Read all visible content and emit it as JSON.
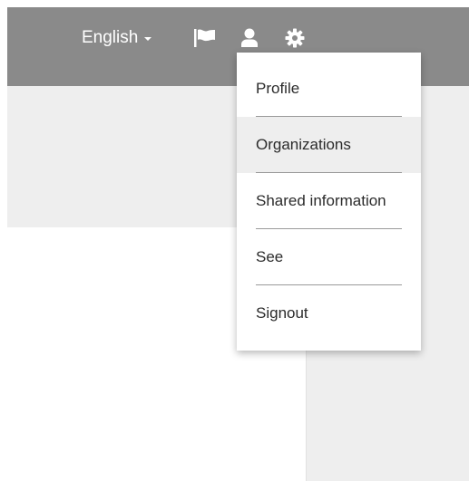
{
  "topbar": {
    "language_label": "English",
    "icons": [
      "flag-icon",
      "user-icon",
      "gear-icon"
    ]
  },
  "menu": {
    "items": [
      {
        "label": "Profile"
      },
      {
        "label": "Organizations",
        "highlighted": true
      },
      {
        "label": "Shared information"
      },
      {
        "label": "See"
      },
      {
        "label": "Signout"
      }
    ]
  },
  "colors": {
    "topbar": "#8a8a8a",
    "panel": "#eeeeee",
    "menu_text": "#2b2b2b",
    "icon": "#ffffff"
  }
}
